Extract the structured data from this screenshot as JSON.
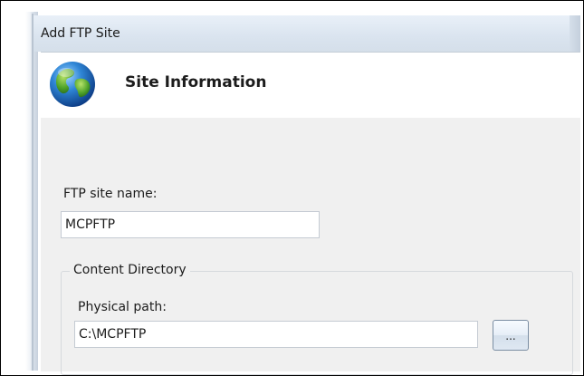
{
  "window": {
    "title": "Add FTP Site"
  },
  "header": {
    "title": "Site Information",
    "icon": "globe-icon"
  },
  "form": {
    "site_name_label": "FTP site name:",
    "site_name_value": "MCPFTP",
    "content_directory": {
      "legend": "Content Directory",
      "physical_path_label": "Physical path:",
      "physical_path_value": "C:\\MCPFTP",
      "browse_label": "..."
    }
  }
}
